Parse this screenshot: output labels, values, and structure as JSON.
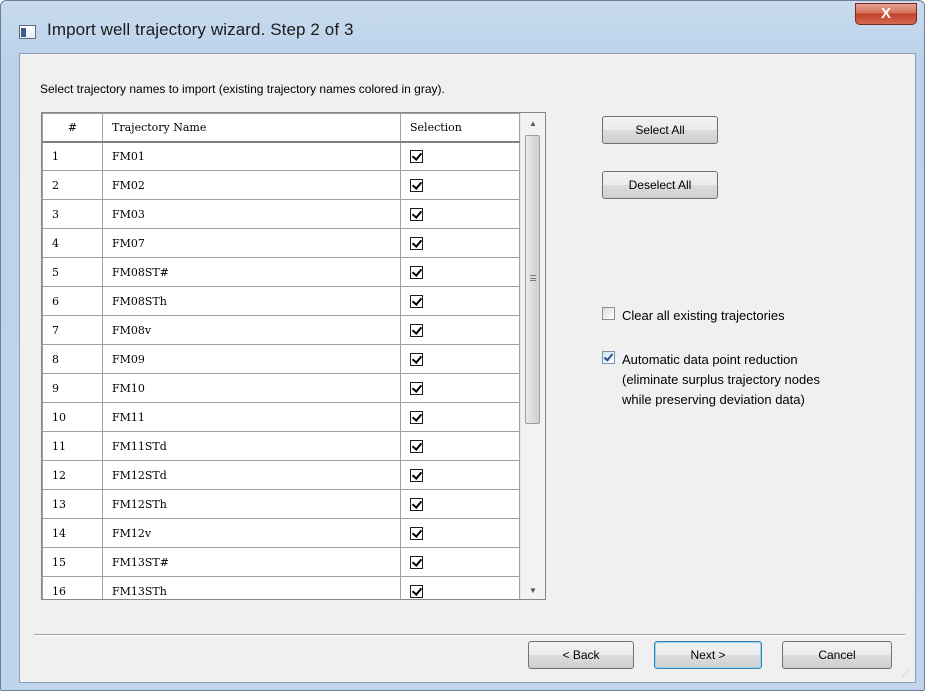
{
  "window": {
    "title": "Import well trajectory wizard. Step 2 of 3",
    "close_label": "X"
  },
  "instruction": "Select trajectory names to import (existing trajectory names colored in gray).",
  "grid": {
    "columns": [
      "#",
      "Trajectory Name",
      "Selection"
    ],
    "rows": [
      {
        "num": "1",
        "name": "FM01",
        "selected": true
      },
      {
        "num": "2",
        "name": "FM02",
        "selected": true
      },
      {
        "num": "3",
        "name": "FM03",
        "selected": true
      },
      {
        "num": "4",
        "name": "FM07",
        "selected": true
      },
      {
        "num": "5",
        "name": "FM08ST#",
        "selected": true
      },
      {
        "num": "6",
        "name": "FM08STh",
        "selected": true
      },
      {
        "num": "7",
        "name": "FM08v",
        "selected": true
      },
      {
        "num": "8",
        "name": "FM09",
        "selected": true
      },
      {
        "num": "9",
        "name": "FM10",
        "selected": true
      },
      {
        "num": "10",
        "name": "FM11",
        "selected": true
      },
      {
        "num": "11",
        "name": "FM11STd",
        "selected": true
      },
      {
        "num": "12",
        "name": "FM12STd",
        "selected": true
      },
      {
        "num": "13",
        "name": "FM12STh",
        "selected": true
      },
      {
        "num": "14",
        "name": "FM12v",
        "selected": true
      },
      {
        "num": "15",
        "name": "FM13ST#",
        "selected": true
      },
      {
        "num": "16",
        "name": "FM13STh",
        "selected": true
      }
    ]
  },
  "buttons": {
    "select_all": "Select All",
    "deselect_all": "Deselect All",
    "back": "< Back",
    "next": "Next >",
    "cancel": "Cancel"
  },
  "options": {
    "clear_existing": {
      "label": "Clear all existing trajectories",
      "checked": false
    },
    "auto_reduction": {
      "label_line1": "Automatic data point reduction",
      "label_line2": "(eliminate surplus trajectory nodes",
      "label_line3": "while preserving deviation data)",
      "checked": true
    }
  }
}
